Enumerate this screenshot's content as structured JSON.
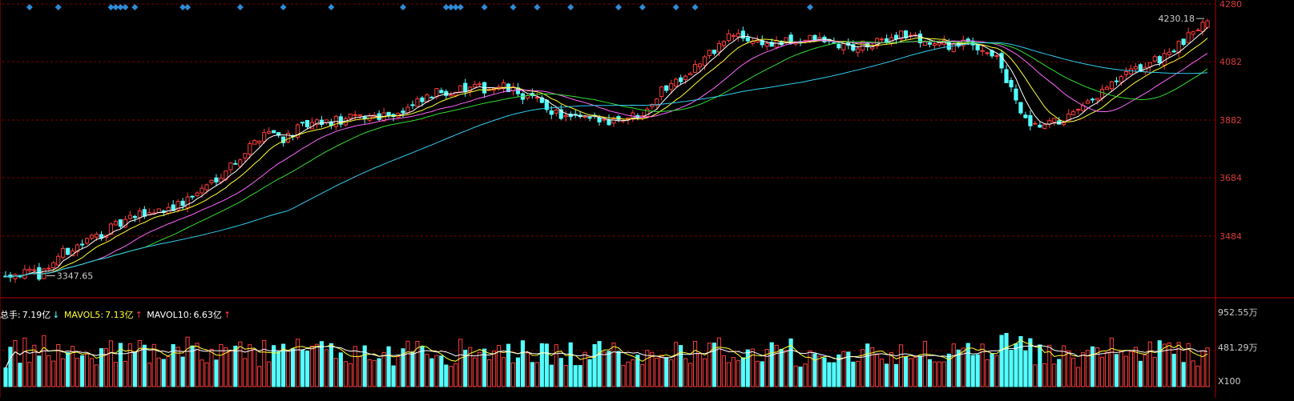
{
  "colors": {
    "background": "#000000",
    "up": "#ff3b3b",
    "down": "#55ffff",
    "grid": "#7a0000",
    "axis_text": "#d83a3a",
    "ma5": "#ffffff",
    "ma10": "#ffff33",
    "ma20": "#ff66ff",
    "ma30": "#33dd33",
    "ma60": "#33ccee",
    "marker": "#2e8bd6"
  },
  "volume_panel": {
    "total_label": "总手:",
    "total_value": "7.19亿",
    "total_arrow": "↓",
    "mavol5_label": "MAVOL5:",
    "mavol5_value": "7.13亿",
    "mavol5_arrow": "↑",
    "mavol10_label": "MAVOL10:",
    "mavol10_value": "6.63亿",
    "mavol10_arrow": "↑",
    "axis_ticks": [
      "952.55万",
      "481.29万",
      "X100"
    ]
  },
  "chart_data": {
    "type": "candlestick",
    "price_axis_ticks": [
      4280,
      4082,
      3882,
      3684,
      3484
    ],
    "ylim": [
      3275,
      4280
    ],
    "volume_ylim": [
      0,
      1000
    ],
    "annotations": {
      "high_label": "4230.18",
      "low_label": "3347.65"
    },
    "grid": true,
    "num_bars": 252,
    "markers_count": 26
  }
}
